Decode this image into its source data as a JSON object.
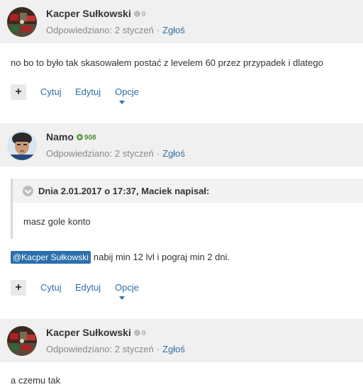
{
  "posts": [
    {
      "author": "Kacper Sułkowski",
      "reputation": "0",
      "reputation_type": "neutral",
      "answered_label": "Odpowiedziano:",
      "date": "2 styczeń",
      "report": "Zgłoś",
      "text": "no bo to było tak skasowałem postać z levelem 60 przez przypadek i dlatego"
    },
    {
      "author": "Namo",
      "reputation": "908",
      "reputation_type": "positive",
      "answered_label": "Odpowiedziano:",
      "date": "2 styczeń",
      "report": "Zgłoś",
      "quote": {
        "cite": "Dnia 2.01.2017 o 17:37, Maciek napisał:",
        "text": "masz gole konto"
      },
      "mention": "@Kacper Sułkowski",
      "text": "nabij min 12 lvl i pograj min 2 dni."
    },
    {
      "author": "Kacper Sułkowski",
      "reputation": "0",
      "reputation_type": "neutral",
      "answered_label": "Odpowiedziano:",
      "date": "2 styczeń",
      "report": "Zgłoś",
      "text": "a czemu tak"
    }
  ],
  "actions": {
    "plus": "+",
    "quote": "Cytuj",
    "edit": "Edytuj",
    "options": "Opcje"
  },
  "colors": {
    "header_bg": "#f0f0f0",
    "link": "#2f6ea8",
    "mention_bg": "#2b6fad",
    "rep_positive": "#5b9a44",
    "rep_neutral": "#bdbdbd"
  }
}
